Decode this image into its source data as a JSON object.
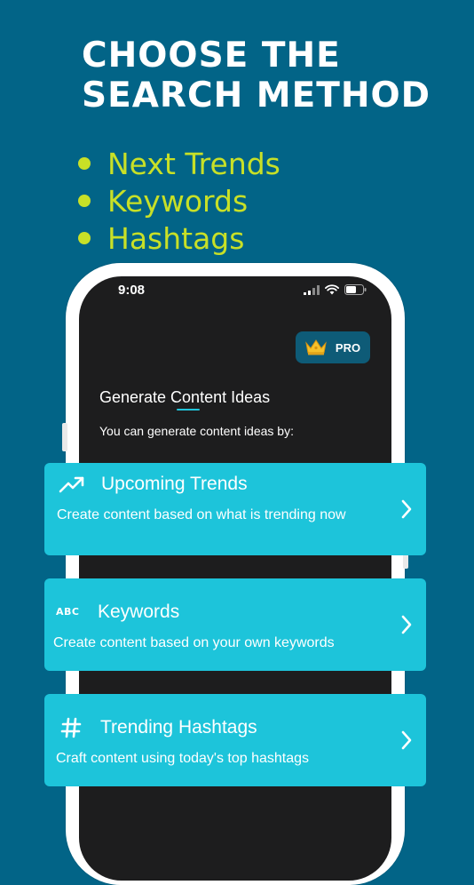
{
  "headline": {
    "line1": "CHOOSE THE",
    "line2": "SEARCH METHOD"
  },
  "bullets": [
    "Next Trends",
    "Keywords",
    "Hashtags"
  ],
  "phone": {
    "status": {
      "time": "9:08"
    },
    "pro_badge": {
      "label": "PRO",
      "icon": "crown-icon"
    },
    "section_title": "Generate Content Ideas",
    "section_subtitle": "You can generate content ideas by:"
  },
  "options": [
    {
      "title": "Upcoming Trends",
      "description": "Create content based on what is trending now",
      "icon": "trending-up-icon"
    },
    {
      "title": "Keywords",
      "description": "Create content based on your own keywords",
      "icon": "abc-icon",
      "icon_text": "ABC"
    },
    {
      "title": "Trending Hashtags",
      "description": "Craft content using today's top hashtags",
      "icon": "hashtag-icon"
    }
  ],
  "colors": {
    "background": "#026487",
    "bullet_accent": "#c8e027",
    "card": "#1dc4da",
    "screen": "#1d1d1e",
    "pro_badge": "#0e5b77"
  }
}
